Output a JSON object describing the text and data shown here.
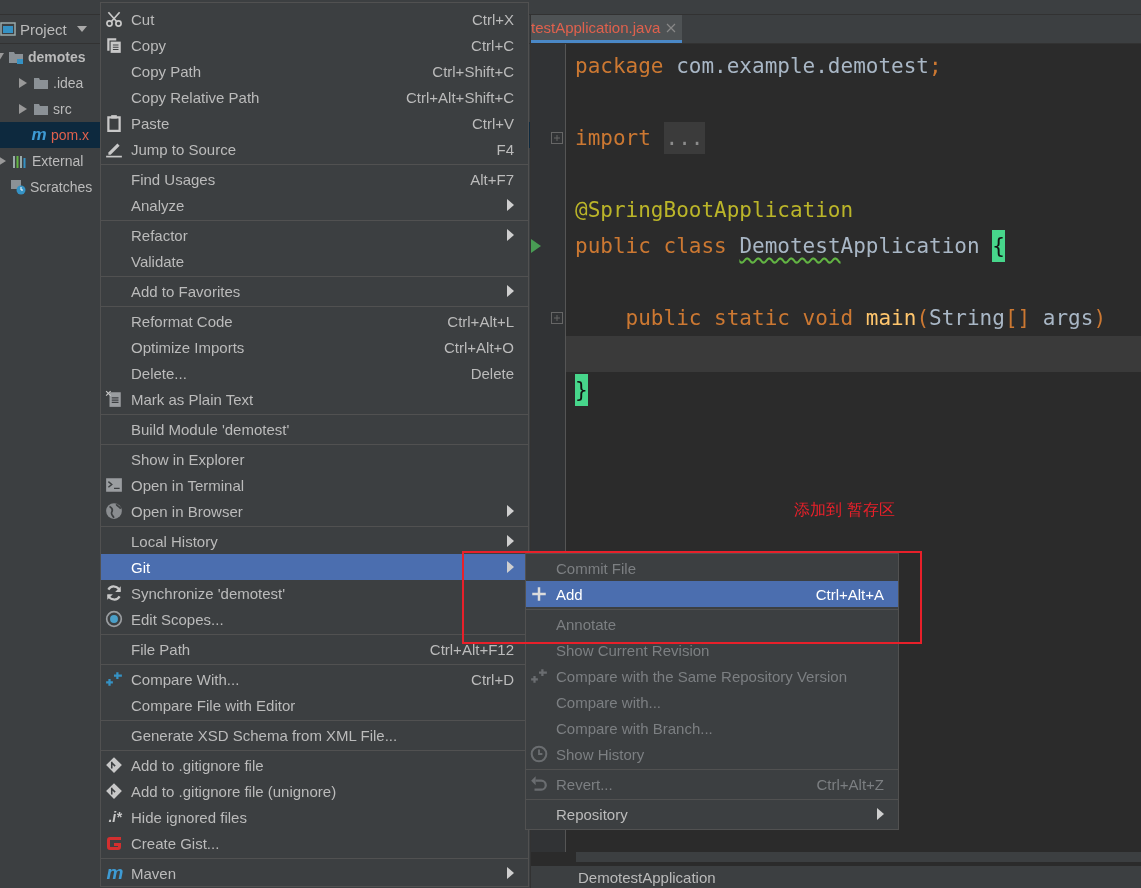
{
  "project_panel": {
    "title": "Project",
    "tree": [
      {
        "label": "demotes",
        "kind": "module",
        "expanded": true,
        "selected": false,
        "children": [
          {
            "label": ".idea",
            "kind": "folder",
            "expanded": false,
            "selected": false
          },
          {
            "label": "src",
            "kind": "folder",
            "expanded": false,
            "selected": false
          },
          {
            "label": "pom.x",
            "kind": "maven-file",
            "icon_text": "m",
            "selected": true
          }
        ]
      },
      {
        "label": "External",
        "kind": "library",
        "expanded": false,
        "selected": false
      },
      {
        "label": "Scratches",
        "kind": "scratches",
        "selected": false
      }
    ]
  },
  "editor": {
    "tab": {
      "label": "testApplication.java",
      "selected": true
    },
    "code": [
      {
        "kind": "code",
        "fold": false,
        "run": false,
        "tokens": [
          {
            "t": "package ",
            "kind": "keyword"
          },
          {
            "t": "com.example.demotest",
            "kind": "plain"
          },
          {
            "t": ";",
            "kind": "keyword"
          }
        ]
      },
      {
        "kind": "blank"
      },
      {
        "kind": "code",
        "fold": true,
        "run": false,
        "tokens": [
          {
            "t": "import ",
            "kind": "keyword"
          },
          {
            "t": "...",
            "kind": "folded"
          }
        ]
      },
      {
        "kind": "blank"
      },
      {
        "kind": "code",
        "fold": false,
        "run": false,
        "tokens": [
          {
            "t": "@SpringBootApplication",
            "kind": "annotation"
          }
        ]
      },
      {
        "kind": "code",
        "fold": false,
        "run": true,
        "tokens": [
          {
            "t": "public class ",
            "kind": "keyword"
          },
          {
            "t": "Demotest",
            "kind": "warning"
          },
          {
            "t": "Application ",
            "kind": "plain"
          },
          {
            "t": "{",
            "kind": "brace"
          }
        ]
      },
      {
        "kind": "blank"
      },
      {
        "kind": "code",
        "fold": true,
        "run": false,
        "tokens": [
          {
            "t": "    public static void ",
            "kind": "keyword"
          },
          {
            "t": "main",
            "kind": "method"
          },
          {
            "t": "(",
            "kind": "keyword"
          },
          {
            "t": "String",
            "kind": "plain"
          },
          {
            "t": "[]",
            "kind": "keyword"
          },
          {
            "t": " args",
            "kind": "plain"
          },
          {
            "t": ")",
            "kind": "keyword"
          }
        ]
      },
      {
        "kind": "blank",
        "current": true
      },
      {
        "kind": "code",
        "fold": false,
        "run": false,
        "tokens": [
          {
            "t": "}",
            "kind": "brace"
          }
        ]
      }
    ],
    "breadcrumb": "DemotestApplication"
  },
  "context_menu": {
    "groups": [
      [
        {
          "label": "Cut",
          "shortcut": "Ctrl+X",
          "submenu": false,
          "selected": false
        },
        {
          "label": "Copy",
          "shortcut": "Ctrl+C",
          "submenu": false,
          "selected": false
        },
        {
          "label": "Copy Path",
          "shortcut": "Ctrl+Shift+C",
          "submenu": false,
          "selected": false
        },
        {
          "label": "Copy Relative Path",
          "shortcut": "Ctrl+Alt+Shift+C",
          "submenu": false,
          "selected": false
        },
        {
          "label": "Paste",
          "shortcut": "Ctrl+V",
          "submenu": false,
          "selected": false
        },
        {
          "label": "Jump to Source",
          "shortcut": "F4",
          "submenu": false,
          "selected": false
        }
      ],
      [
        {
          "label": "Find Usages",
          "shortcut": "Alt+F7",
          "submenu": false,
          "selected": false
        },
        {
          "label": "Analyze",
          "submenu": true,
          "selected": false
        }
      ],
      [
        {
          "label": "Refactor",
          "submenu": true,
          "selected": false
        },
        {
          "label": "Validate",
          "submenu": false,
          "selected": false
        }
      ],
      [
        {
          "label": "Add to Favorites",
          "submenu": true,
          "selected": false
        }
      ],
      [
        {
          "label": "Reformat Code",
          "shortcut": "Ctrl+Alt+L",
          "submenu": false,
          "selected": false
        },
        {
          "label": "Optimize Imports",
          "shortcut": "Ctrl+Alt+O",
          "submenu": false,
          "selected": false
        },
        {
          "label": "Delete...",
          "shortcut": "Delete",
          "submenu": false,
          "selected": false
        },
        {
          "label": "Mark as Plain Text",
          "submenu": false,
          "selected": false
        }
      ],
      [
        {
          "label": "Build Module 'demotest'",
          "submenu": false,
          "selected": false
        }
      ],
      [
        {
          "label": "Show in Explorer",
          "submenu": false,
          "selected": false
        },
        {
          "label": "Open in Terminal",
          "submenu": false,
          "selected": false
        },
        {
          "label": "Open in Browser",
          "submenu": true,
          "selected": false
        }
      ],
      [
        {
          "label": "Local History",
          "submenu": true,
          "selected": false
        },
        {
          "label": "Git",
          "submenu": true,
          "selected": true
        },
        {
          "label": "Synchronize 'demotest'",
          "submenu": false,
          "selected": false
        },
        {
          "label": "Edit Scopes...",
          "submenu": false,
          "selected": false
        }
      ],
      [
        {
          "label": "File Path",
          "shortcut": "Ctrl+Alt+F12",
          "submenu": false,
          "selected": false
        }
      ],
      [
        {
          "label": "Compare With...",
          "shortcut": "Ctrl+D",
          "submenu": false,
          "selected": false
        },
        {
          "label": "Compare File with Editor",
          "submenu": false,
          "selected": false
        }
      ],
      [
        {
          "label": "Generate XSD Schema from XML File...",
          "submenu": false,
          "selected": false
        }
      ],
      [
        {
          "label": "Add to .gitignore file",
          "submenu": false,
          "selected": false
        },
        {
          "label": "Add to .gitignore file (unignore)",
          "submenu": false,
          "selected": false
        },
        {
          "label": "Hide ignored files",
          "icon_text": ".i*",
          "submenu": false,
          "selected": false
        },
        {
          "label": "Create Gist...",
          "submenu": false,
          "selected": false
        }
      ],
      [
        {
          "label": "Maven",
          "icon_text": "m",
          "submenu": true,
          "selected": false
        }
      ]
    ]
  },
  "git_submenu": {
    "groups": [
      [
        {
          "label": "Commit File",
          "disabled": true,
          "submenu": false,
          "selected": false
        },
        {
          "label": "Add",
          "shortcut": "Ctrl+Alt+A",
          "disabled": false,
          "submenu": false,
          "selected": true
        }
      ],
      [
        {
          "label": "Annotate",
          "disabled": true,
          "submenu": false,
          "selected": false
        },
        {
          "label": "Show Current Revision",
          "disabled": true,
          "submenu": false,
          "selected": false
        },
        {
          "label": "Compare with the Same Repository Version",
          "disabled": true,
          "submenu": false,
          "selected": false
        },
        {
          "label": "Compare with...",
          "disabled": true,
          "submenu": false,
          "selected": false
        },
        {
          "label": "Compare with Branch...",
          "disabled": true,
          "submenu": false,
          "selected": false
        },
        {
          "label": "Show History",
          "disabled": true,
          "submenu": false,
          "selected": false
        }
      ],
      [
        {
          "label": "Revert...",
          "shortcut": "Ctrl+Alt+Z",
          "disabled": true,
          "submenu": false,
          "selected": false
        }
      ],
      [
        {
          "label": "Repository",
          "disabled": false,
          "submenu": true,
          "selected": false
        }
      ]
    ]
  },
  "annotation": {
    "text": "添加到 暂存区"
  }
}
